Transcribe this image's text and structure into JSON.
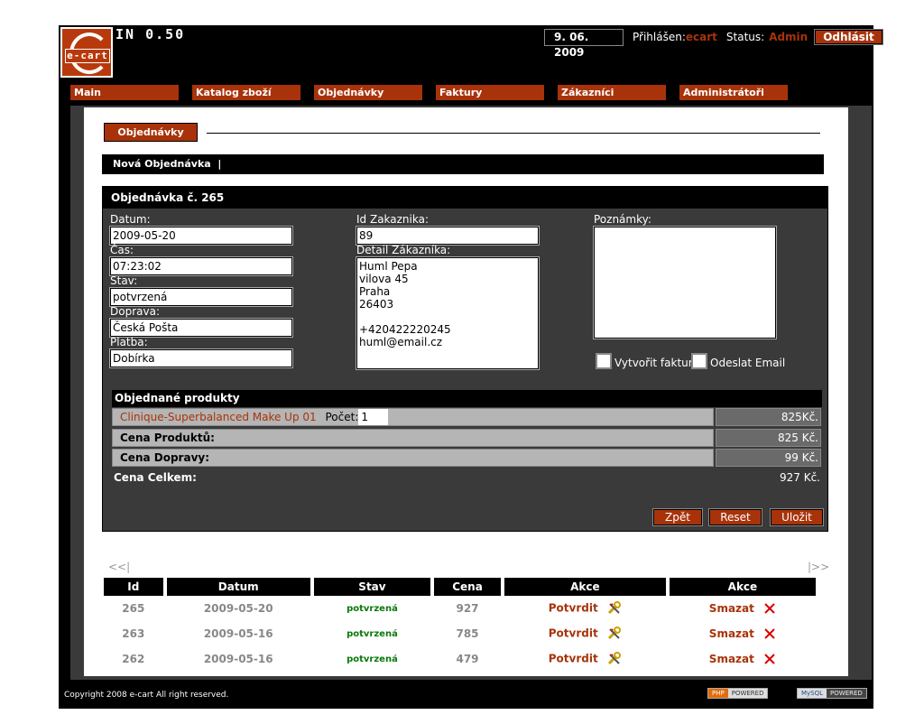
{
  "header": {
    "logo_text": "e-cart",
    "version": "IN 0.50",
    "date": "9. 06. 2009",
    "logged_label": "Přihlášen:",
    "logged_user": "ecart",
    "status_label": "Status:",
    "status_value": "Admin",
    "logout_label": "Odhlásit"
  },
  "nav": {
    "items": [
      {
        "label": "Main"
      },
      {
        "label": "Katalog zboží"
      },
      {
        "label": "Objednávky"
      },
      {
        "label": "Faktury"
      },
      {
        "label": "Zákazníci"
      },
      {
        "label": "Administrátoři"
      }
    ]
  },
  "page": {
    "heading": "Objednávky",
    "subnav_label": "Nová Objednávka  |"
  },
  "order": {
    "title": "Objednávka č. 265",
    "datum_label": "Datum:",
    "datum_value": "2009-05-20",
    "cas_label": "Čas:",
    "cas_value": "07:23:02",
    "stav_label": "Stav:",
    "stav_value": "potvrzená",
    "doprava_label": "Doprava:",
    "doprava_value": "Česká Pošta",
    "platba_label": "Platba:",
    "platba_value": "Dobírka",
    "id_label": "Id Zakaznika:",
    "id_value": "89",
    "detail_label": "Detail Zákazníka:",
    "detail_lines": [
      "Huml Pepa",
      "vilova 45",
      "Praha",
      "26403",
      "",
      "+420422220245",
      "huml@email.cz"
    ],
    "notes_label": "Poznámky:",
    "notes_value": "",
    "chk_invoice_label": "Vytvořit fakturu",
    "chk_email_label": "Odeslat Email",
    "products_heading": "Objednané produkty",
    "product_name": "Clinique-Superbalanced Make Up 01",
    "count_label": "Počet:",
    "count_value": "1",
    "product_price": "825Kč.",
    "products_total_label": "Cena Produktů:",
    "products_total_value": "825 Kč.",
    "shipping_label": "Cena Dopravy:",
    "shipping_value": "99 Kč.",
    "total_label": "Cena Celkem:",
    "total_value": "927 Kč.",
    "btn_back": "Zpět",
    "btn_reset": "Reset",
    "btn_save": "Uložit"
  },
  "list": {
    "prev": "<<|",
    "next": "|>>",
    "columns": [
      "Id",
      "Datum",
      "Stav",
      "Cena",
      "Akce",
      "Akce"
    ],
    "rows": [
      {
        "id": "265",
        "datum": "2009-05-20",
        "stav": "potvrzená",
        "cena": "927",
        "confirm": "Potvrdit",
        "delete": "Smazat"
      },
      {
        "id": "263",
        "datum": "2009-05-16",
        "stav": "potvrzená",
        "cena": "785",
        "confirm": "Potvrdit",
        "delete": "Smazat"
      },
      {
        "id": "262",
        "datum": "2009-05-16",
        "stav": "potvrzená",
        "cena": "479",
        "confirm": "Potvrdit",
        "delete": "Smazat"
      }
    ]
  },
  "footer": {
    "copyright": "Copyright 2008 e-cart All right reserved.",
    "php_badge_left": "PHP",
    "php_badge_right": "POWERED",
    "mysql_badge_left": "MySQL",
    "mysql_badge_right": "POWERED"
  },
  "colors": {
    "accent": "#a8330a",
    "dark_panel": "#3a3a3a",
    "status_green": "#0a7a0a"
  }
}
